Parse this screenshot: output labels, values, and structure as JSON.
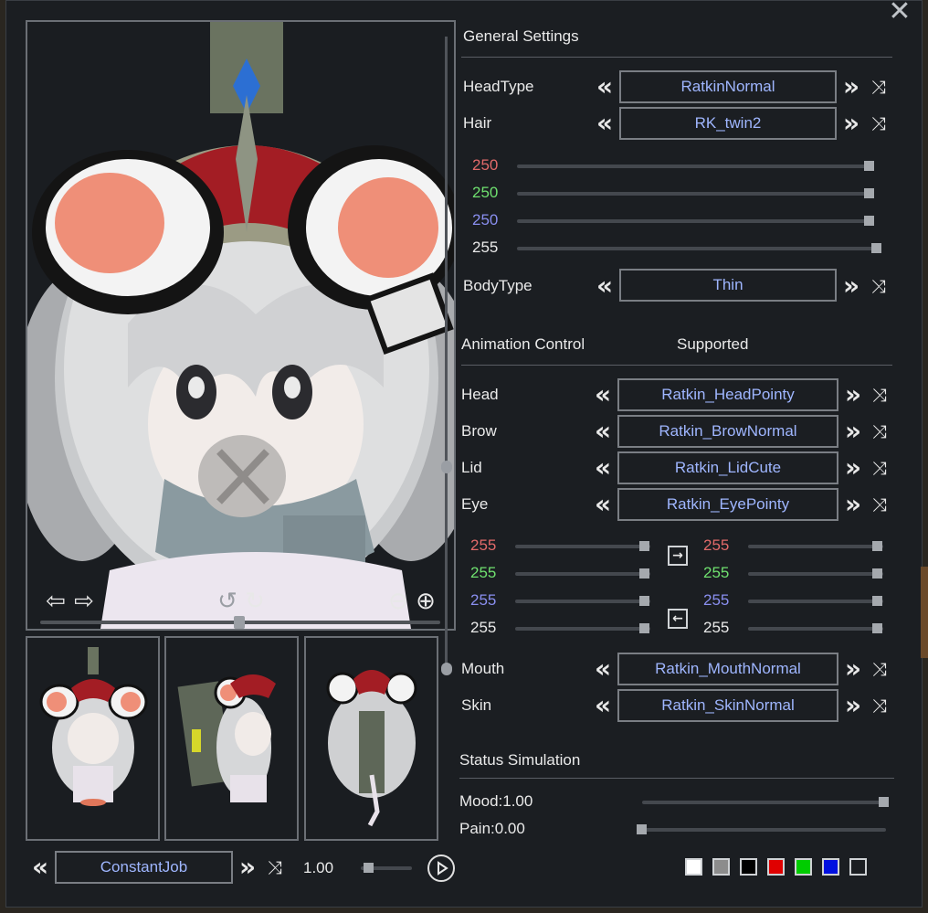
{
  "window": {
    "close_icon": "close-icon"
  },
  "viewport": {
    "character": "Ratkin character portrait",
    "icons": {
      "rotate_left": "⇦",
      "rotate_right": "⇨",
      "turn_ccw": "↺",
      "turn_cw": "↻",
      "zoom_out": "⊖",
      "zoom_in": "⊕"
    }
  },
  "general": {
    "title": "General Settings",
    "head_type": {
      "label": "HeadType",
      "value": "RatkinNormal"
    },
    "hair": {
      "label": "Hair",
      "value": "RK_twin2"
    },
    "hair_color": [
      {
        "value": "250",
        "color": "#e26a6a"
      },
      {
        "value": "250",
        "color": "#6fe06f"
      },
      {
        "value": "250",
        "color": "#8a8ff0"
      },
      {
        "value": "255",
        "color": "#eaeaea"
      }
    ],
    "body_type": {
      "label": "BodyType",
      "value": "Thin"
    }
  },
  "animation": {
    "title": "Animation Control",
    "status": "Supported",
    "rows": [
      {
        "label": "Head",
        "value": "Ratkin_HeadPointy"
      },
      {
        "label": "Brow",
        "value": "Ratkin_BrowNormal"
      },
      {
        "label": "Lid",
        "value": "Ratkin_LidCute"
      },
      {
        "label": "Eye",
        "value": "Ratkin_EyePointy"
      }
    ],
    "eye_color_left": [
      {
        "value": "255",
        "color": "#e26a6a"
      },
      {
        "value": "255",
        "color": "#6fe06f"
      },
      {
        "value": "255",
        "color": "#8a8ff0"
      },
      {
        "value": "255",
        "color": "#eaeaea"
      }
    ],
    "eye_color_right": [
      {
        "value": "255",
        "color": "#e26a6a"
      },
      {
        "value": "255",
        "color": "#6fe06f"
      },
      {
        "value": "255",
        "color": "#8a8ff0"
      },
      {
        "value": "255",
        "color": "#eaeaea"
      }
    ],
    "copy_right_icon": "→",
    "copy_left_icon": "←",
    "rows2": [
      {
        "label": "Mouth",
        "value": "Ratkin_MouthNormal"
      },
      {
        "label": "Skin",
        "value": "Ratkin_SkinNormal"
      }
    ]
  },
  "status": {
    "title": "Status Simulation",
    "mood": {
      "label": "Mood:1.00",
      "fraction": 1.0
    },
    "pain": {
      "label": "Pain:0.00",
      "fraction": 0.0
    }
  },
  "footer": {
    "job": "ConstantJob",
    "speed": "1.00",
    "swatches": [
      "#ffffff",
      "#8c8c8c",
      "#000000",
      "#e00000",
      "#00cc00",
      "#0010e0",
      "#1b1e22"
    ]
  },
  "glyphs": {
    "prev": "«",
    "next": "»",
    "shuffle": "⤨"
  }
}
